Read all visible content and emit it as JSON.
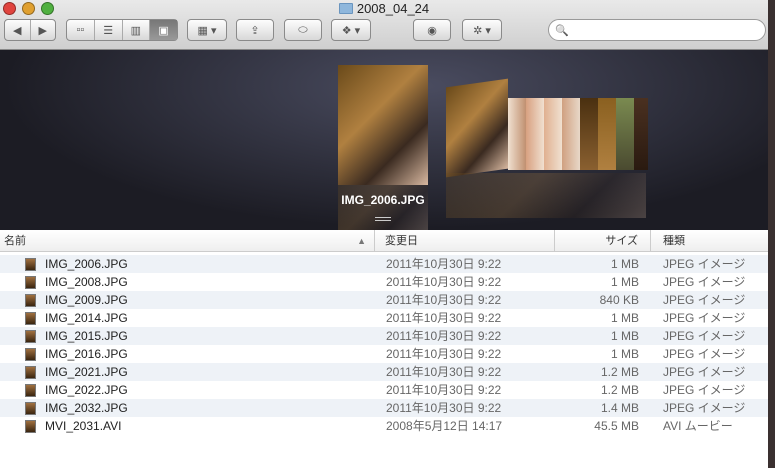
{
  "window": {
    "title": "2008_04_24"
  },
  "toolbar": {
    "back": "◀",
    "forward": "▶",
    "views": [
      "▫▫",
      "☰",
      "▥",
      "▣"
    ],
    "arrange": "▦ ▾",
    "share": "⇪",
    "tag": "⬭",
    "dropbox": "❖ ▾",
    "quicklook": "◉",
    "action": "✲ ▾",
    "search_placeholder": "",
    "search_icon": "🔍"
  },
  "coverflow": {
    "caption": "IMG_2006.JPG"
  },
  "columns": {
    "name": "名前",
    "sort": "▲",
    "date": "変更日",
    "size": "サイズ",
    "kind": "種類"
  },
  "files": [
    {
      "name": "IMG_2006.JPG",
      "date": "2011年10月30日 9:22",
      "size": "1 MB",
      "kind": "JPEG イメージ"
    },
    {
      "name": "IMG_2008.JPG",
      "date": "2011年10月30日 9:22",
      "size": "1 MB",
      "kind": "JPEG イメージ"
    },
    {
      "name": "IMG_2009.JPG",
      "date": "2011年10月30日 9:22",
      "size": "840 KB",
      "kind": "JPEG イメージ"
    },
    {
      "name": "IMG_2014.JPG",
      "date": "2011年10月30日 9:22",
      "size": "1 MB",
      "kind": "JPEG イメージ"
    },
    {
      "name": "IMG_2015.JPG",
      "date": "2011年10月30日 9:22",
      "size": "1 MB",
      "kind": "JPEG イメージ"
    },
    {
      "name": "IMG_2016.JPG",
      "date": "2011年10月30日 9:22",
      "size": "1 MB",
      "kind": "JPEG イメージ"
    },
    {
      "name": "IMG_2021.JPG",
      "date": "2011年10月30日 9:22",
      "size": "1.2 MB",
      "kind": "JPEG イメージ"
    },
    {
      "name": "IMG_2022.JPG",
      "date": "2011年10月30日 9:22",
      "size": "1.2 MB",
      "kind": "JPEG イメージ"
    },
    {
      "name": "IMG_2032.JPG",
      "date": "2011年10月30日 9:22",
      "size": "1.4 MB",
      "kind": "JPEG イメージ"
    },
    {
      "name": "MVI_2031.AVI",
      "date": "2008年5月12日 14:17",
      "size": "45.5 MB",
      "kind": "AVI ムービー"
    }
  ]
}
